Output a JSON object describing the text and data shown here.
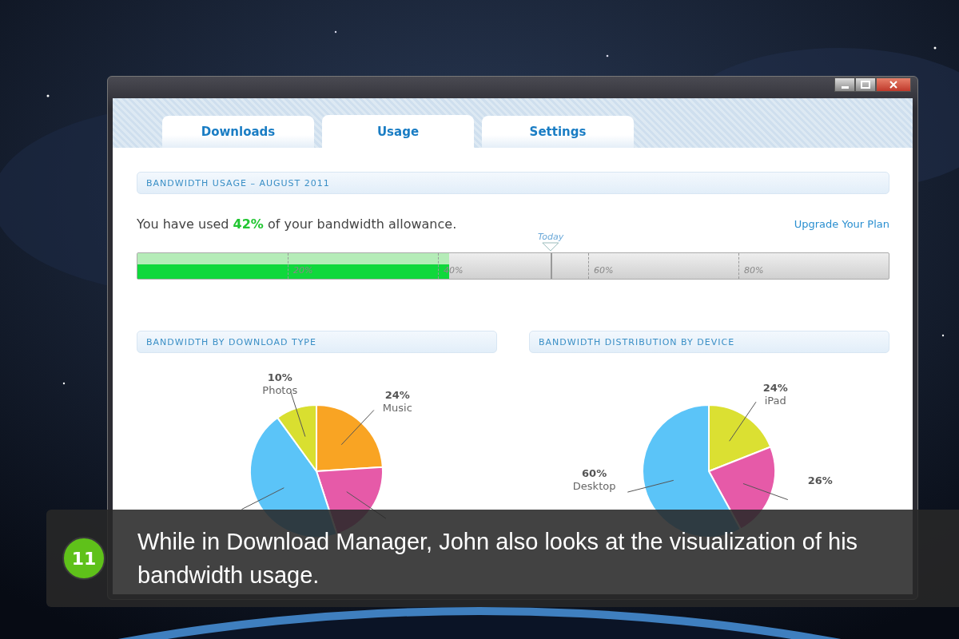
{
  "tabs": [
    {
      "label": "Downloads",
      "selected": false
    },
    {
      "label": "Usage",
      "selected": true
    },
    {
      "label": "Settings",
      "selected": false
    }
  ],
  "usage": {
    "header": "BANDWIDTH USAGE – AUGUST 2011",
    "summary": "You have used **42%** of your bandwidth allowance.",
    "upgrade_link": "Upgrade Your Plan",
    "today": {
      "label": "Today",
      "level": 0.55
    },
    "level": 0.415,
    "ticks": [
      "20%",
      "40%",
      "60%",
      "80%"
    ]
  },
  "charts": [
    {
      "header": "BANDWIDTH BY DOWNLOAD TYPE",
      "slices": [
        {
          "name": "Music",
          "percent": "24%",
          "color": "#f9a423"
        },
        {
          "color": "#e65aa8"
        },
        {
          "color": "#5bc4f8"
        },
        {
          "name": "Photos",
          "percent": "10%",
          "color": "#d9df30"
        }
      ],
      "chart_data": {
        "type": "pie",
        "values": [
          24,
          21,
          45,
          10
        ]
      }
    },
    {
      "header": "BANDWIDTH DISTRIBUTION BY DEVICE",
      "slices": [
        {
          "name": "iPad",
          "percent": "24%",
          "color": "#dbe032"
        },
        {
          "percent": "26%",
          "color": "#e65aa8"
        },
        {
          "name": "Desktop",
          "percent": "60%",
          "color": "#5bc4f8"
        }
      ],
      "chart_data": {
        "type": "pie",
        "values": [
          19,
          23,
          58
        ]
      }
    }
  ],
  "caption": {
    "step": "11",
    "text": "While in Download Manager, John also looks at the visualization of his bandwidth usage."
  }
}
